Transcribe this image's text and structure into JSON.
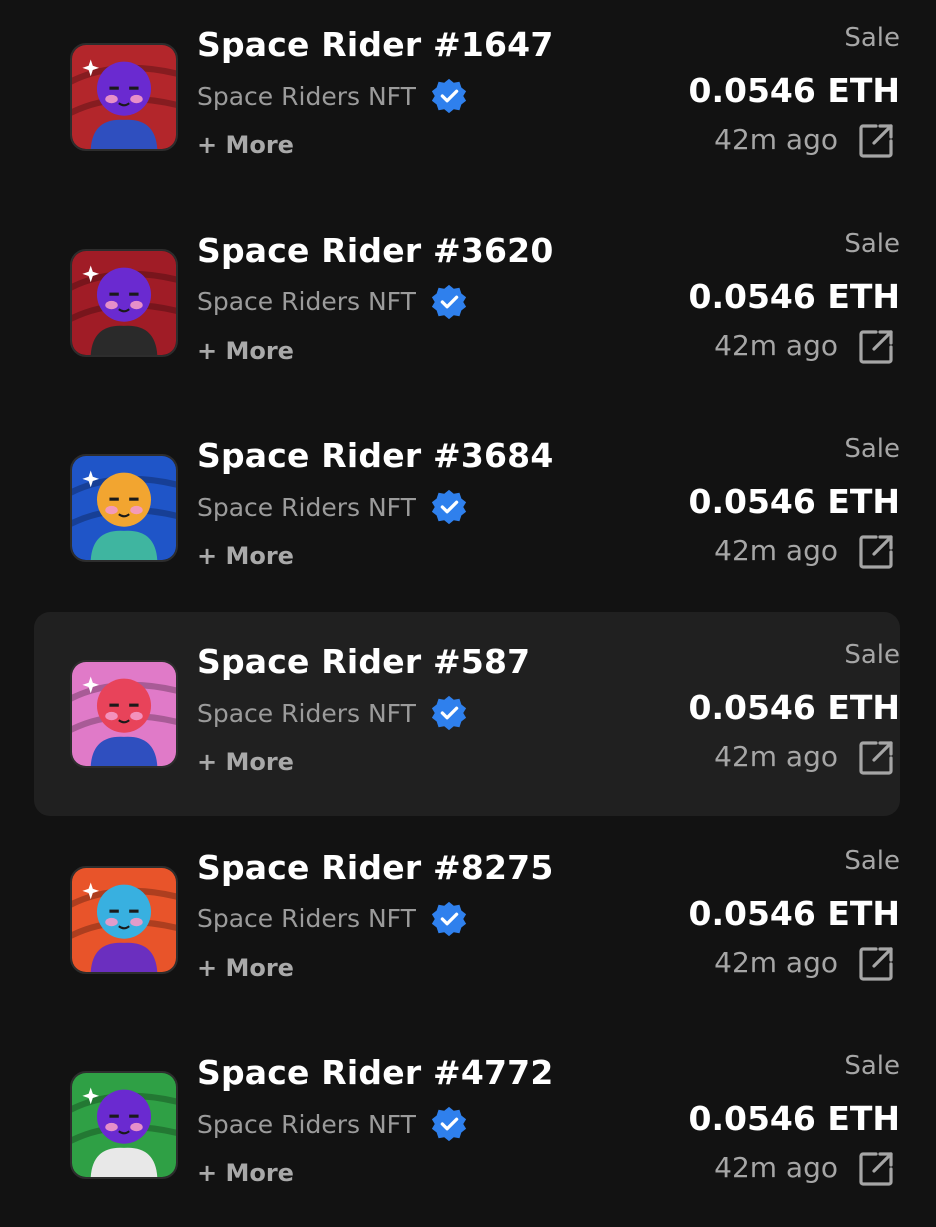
{
  "accent_colors": {
    "verified_badge": "#2f80ed",
    "highlight_row": "#202020",
    "background": "#121212"
  },
  "items": [
    {
      "name": "Space Rider #1647",
      "collection": "Space Riders NFT",
      "more": "+ More",
      "type": "Sale",
      "price": "0.0546 ETH",
      "time": "42m ago",
      "bg": "#b3262b",
      "face": "#6a2ad0",
      "suit": "#2f4fbf",
      "hat": "#222"
    },
    {
      "name": "Space Rider #3620",
      "collection": "Space Riders NFT",
      "more": "+ More",
      "type": "Sale",
      "price": "0.0546 ETH",
      "time": "42m ago",
      "bg": "#a01c26",
      "face": "#6a2ad0",
      "suit": "#2a2a2a",
      "hat": ""
    },
    {
      "name": "Space Rider #3684",
      "collection": "Space Riders NFT",
      "more": "+ More",
      "type": "Sale",
      "price": "0.0546 ETH",
      "time": "42m ago",
      "bg": "#1f55c8",
      "face": "#f2a530",
      "suit": "#3fb5a0",
      "hat": ""
    },
    {
      "name": "Space Rider #587",
      "collection": "Space Riders NFT",
      "more": "+ More",
      "type": "Sale",
      "price": "0.0546 ETH",
      "time": "42m ago",
      "bg": "#e07ac8",
      "face": "#e8435a",
      "suit": "#2f4fbf",
      "hat": ""
    },
    {
      "name": "Space Rider #8275",
      "collection": "Space Riders NFT",
      "more": "+ More",
      "type": "Sale",
      "price": "0.0546 ETH",
      "time": "42m ago",
      "bg": "#e8542a",
      "face": "#38b0e0",
      "suit": "#6b2fbf",
      "hat": ""
    },
    {
      "name": "Space Rider #4772",
      "collection": "Space Riders NFT",
      "more": "+ More",
      "type": "Sale",
      "price": "0.0546 ETH",
      "time": "42m ago",
      "bg": "#2fa045",
      "face": "#6a2ad0",
      "suit": "#e8e8e8",
      "hat": ""
    }
  ]
}
